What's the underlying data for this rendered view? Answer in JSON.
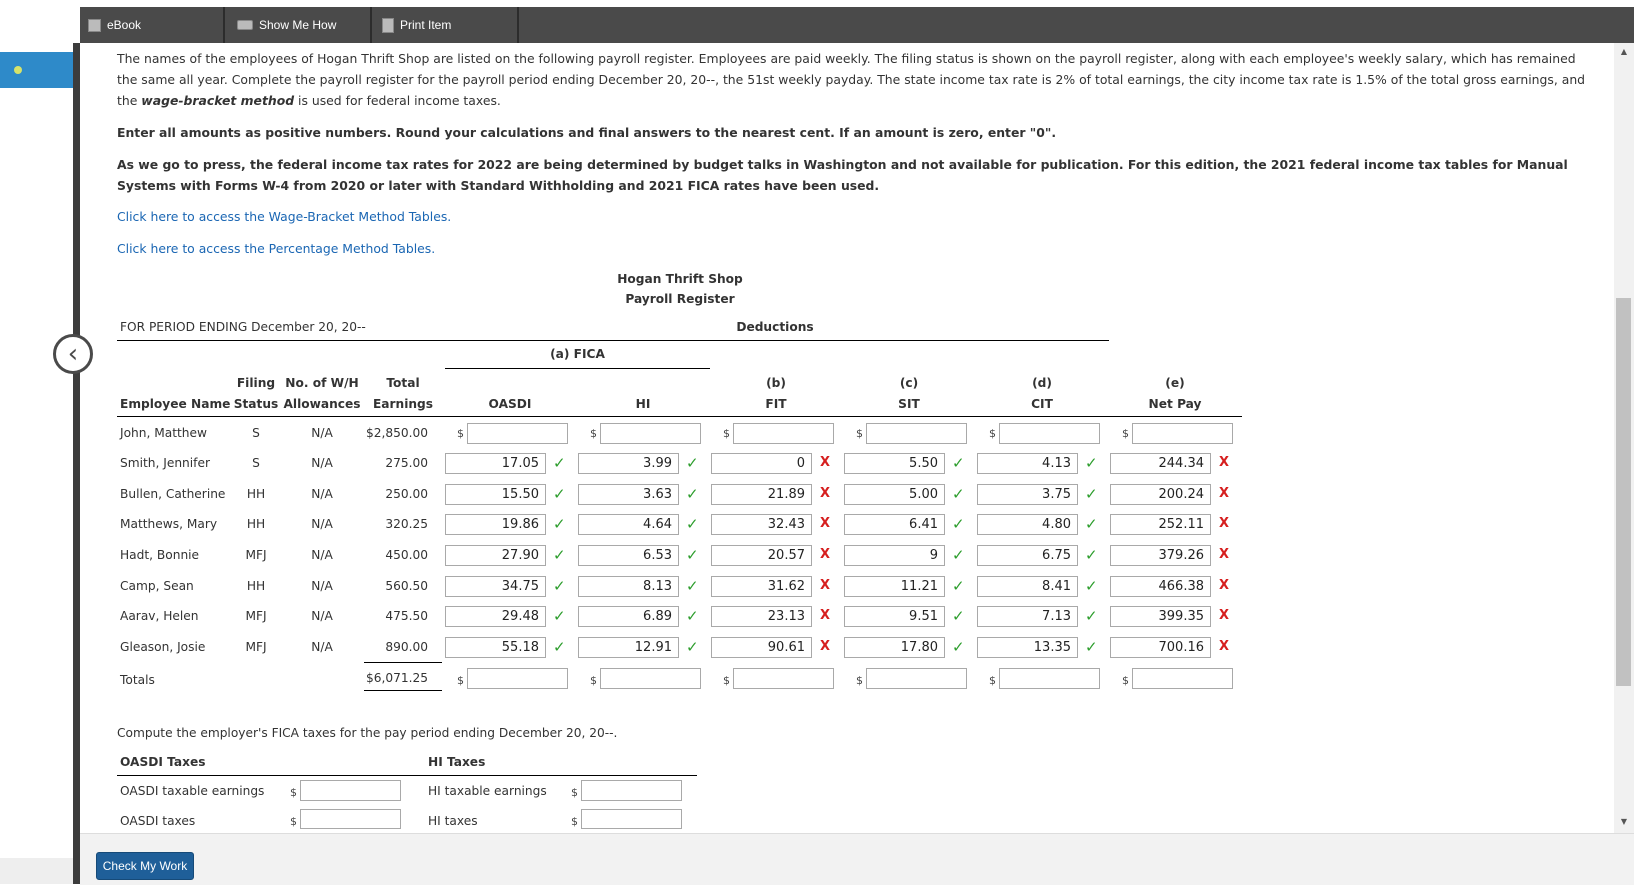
{
  "toolbar": {
    "ebook": "eBook",
    "show_me_how": "Show Me How",
    "print_item": "Print Item"
  },
  "instructions": {
    "p1_a": "The names of the employees of Hogan Thrift Shop are listed on the following payroll register. Employees are paid weekly. The filing status is shown on the payroll register, along with each employee's weekly salary, which has remained the same all year. Complete the payroll register for the payroll period ending December 20, 20--, the 51st weekly payday. The state income tax rate is 2% of total earnings, the city income tax rate is 1.5% of the total gross earnings, and the ",
    "p1_em": "wage-bracket method",
    "p1_b": " is used for federal income taxes.",
    "p2": "Enter all amounts as positive numbers. Round your calculations and final answers to the nearest cent. If an amount is zero, enter \"0\".",
    "p3": "As we go to press, the federal income tax rates for 2022 are being determined by budget talks in Washington and not available for publication. For this edition, the 2021 federal income tax tables for Manual Systems with Forms W-4 from 2020 or later with Standard Withholding and 2021 FICA rates have been used.",
    "link1": "Click here to access the Wage-Bracket Method Tables.",
    "link2": "Click here to access the Percentage Method Tables."
  },
  "register": {
    "title1": "Hogan Thrift Shop",
    "title2": "Payroll Register",
    "period": "FOR PERIOD ENDING December 20, 20--",
    "deductions": "Deductions",
    "fica": "(a) FICA",
    "headers": {
      "filing_top": "Filing",
      "filing_bottom": "Status",
      "wh_top": "No. of W/H",
      "wh_bottom": "Allowances",
      "total_top": "Total",
      "total_bottom": "Earnings",
      "employee": "Employee Name",
      "oasdi": "OASDI",
      "hi": "HI",
      "b_top": "(b)",
      "b_bottom": "FIT",
      "c_top": "(c)",
      "c_bottom": "SIT",
      "d_top": "(d)",
      "d_bottom": "CIT",
      "e_top": "(e)",
      "e_bottom": "Net Pay"
    },
    "currency": "$",
    "rows": [
      {
        "name": "John, Matthew",
        "status": "S",
        "wh": "N/A",
        "total": "$2,850.00",
        "oasdi": "",
        "hi": "",
        "fit": "",
        "sit": "",
        "cit": "",
        "net": ""
      },
      {
        "name": "Smith, Jennifer",
        "status": "S",
        "wh": "N/A",
        "total": "275.00",
        "oasdi": "17.05",
        "hi": "3.99",
        "fit": "0",
        "sit": "5.50",
        "cit": "4.13",
        "net": "244.34"
      },
      {
        "name": "Bullen, Catherine",
        "status": "HH",
        "wh": "N/A",
        "total": "250.00",
        "oasdi": "15.50",
        "hi": "3.63",
        "fit": "21.89",
        "sit": "5.00",
        "cit": "3.75",
        "net": "200.24"
      },
      {
        "name": "Matthews, Mary",
        "status": "HH",
        "wh": "N/A",
        "total": "320.25",
        "oasdi": "19.86",
        "hi": "4.64",
        "fit": "32.43",
        "sit": "6.41",
        "cit": "4.80",
        "net": "252.11"
      },
      {
        "name": "Hadt, Bonnie",
        "status": "MFJ",
        "wh": "N/A",
        "total": "450.00",
        "oasdi": "27.90",
        "hi": "6.53",
        "fit": "20.57",
        "sit": "9",
        "cit": "6.75",
        "net": "379.26"
      },
      {
        "name": "Camp, Sean",
        "status": "HH",
        "wh": "N/A",
        "total": "560.50",
        "oasdi": "34.75",
        "hi": "8.13",
        "fit": "31.62",
        "sit": "11.21",
        "cit": "8.41",
        "net": "466.38"
      },
      {
        "name": "Aarav, Helen",
        "status": "MFJ",
        "wh": "N/A",
        "total": "475.50",
        "oasdi": "29.48",
        "hi": "6.89",
        "fit": "23.13",
        "sit": "9.51",
        "cit": "7.13",
        "net": "399.35"
      },
      {
        "name": "Gleason, Josie",
        "status": "MFJ",
        "wh": "N/A",
        "total": "890.00",
        "oasdi": "55.18",
        "hi": "12.91",
        "fit": "90.61",
        "sit": "17.80",
        "cit": "13.35",
        "net": "700.16"
      }
    ],
    "totals_label": "Totals",
    "totals_total": "$6,071.25"
  },
  "employer": {
    "prompt": "Compute the employer's FICA taxes for the pay period ending December 20, 20--.",
    "oasdi_header": "OASDI Taxes",
    "hi_header": "HI Taxes",
    "oasdi_earnings": "OASDI taxable earnings",
    "oasdi_taxes": "OASDI taxes",
    "hi_earnings": "HI taxable earnings",
    "hi_taxes": "HI taxes"
  },
  "marks": {
    "check": "✓",
    "cross": "X"
  },
  "footer": {
    "check_my_work": "Check My Work"
  }
}
